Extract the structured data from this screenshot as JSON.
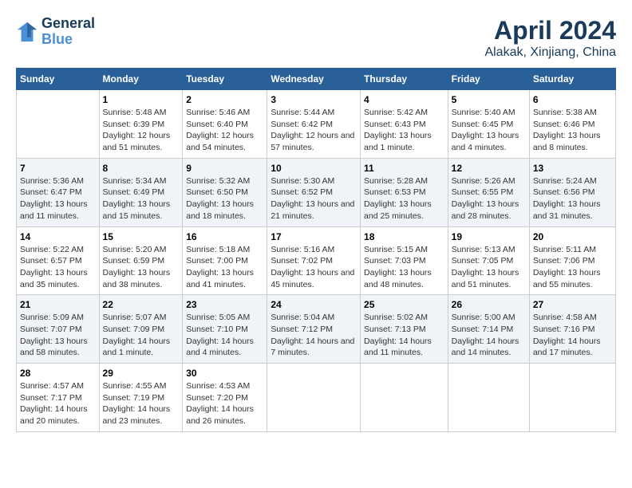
{
  "header": {
    "logo_line1": "General",
    "logo_line2": "Blue",
    "title": "April 2024",
    "subtitle": "Alakak, Xinjiang, China"
  },
  "weekdays": [
    "Sunday",
    "Monday",
    "Tuesday",
    "Wednesday",
    "Thursday",
    "Friday",
    "Saturday"
  ],
  "weeks": [
    [
      {
        "day": "",
        "sunrise": "",
        "sunset": "",
        "daylight": ""
      },
      {
        "day": "1",
        "sunrise": "Sunrise: 5:48 AM",
        "sunset": "Sunset: 6:39 PM",
        "daylight": "Daylight: 12 hours and 51 minutes."
      },
      {
        "day": "2",
        "sunrise": "Sunrise: 5:46 AM",
        "sunset": "Sunset: 6:40 PM",
        "daylight": "Daylight: 12 hours and 54 minutes."
      },
      {
        "day": "3",
        "sunrise": "Sunrise: 5:44 AM",
        "sunset": "Sunset: 6:42 PM",
        "daylight": "Daylight: 12 hours and 57 minutes."
      },
      {
        "day": "4",
        "sunrise": "Sunrise: 5:42 AM",
        "sunset": "Sunset: 6:43 PM",
        "daylight": "Daylight: 13 hours and 1 minute."
      },
      {
        "day": "5",
        "sunrise": "Sunrise: 5:40 AM",
        "sunset": "Sunset: 6:45 PM",
        "daylight": "Daylight: 13 hours and 4 minutes."
      },
      {
        "day": "6",
        "sunrise": "Sunrise: 5:38 AM",
        "sunset": "Sunset: 6:46 PM",
        "daylight": "Daylight: 13 hours and 8 minutes."
      }
    ],
    [
      {
        "day": "7",
        "sunrise": "Sunrise: 5:36 AM",
        "sunset": "Sunset: 6:47 PM",
        "daylight": "Daylight: 13 hours and 11 minutes."
      },
      {
        "day": "8",
        "sunrise": "Sunrise: 5:34 AM",
        "sunset": "Sunset: 6:49 PM",
        "daylight": "Daylight: 13 hours and 15 minutes."
      },
      {
        "day": "9",
        "sunrise": "Sunrise: 5:32 AM",
        "sunset": "Sunset: 6:50 PM",
        "daylight": "Daylight: 13 hours and 18 minutes."
      },
      {
        "day": "10",
        "sunrise": "Sunrise: 5:30 AM",
        "sunset": "Sunset: 6:52 PM",
        "daylight": "Daylight: 13 hours and 21 minutes."
      },
      {
        "day": "11",
        "sunrise": "Sunrise: 5:28 AM",
        "sunset": "Sunset: 6:53 PM",
        "daylight": "Daylight: 13 hours and 25 minutes."
      },
      {
        "day": "12",
        "sunrise": "Sunrise: 5:26 AM",
        "sunset": "Sunset: 6:55 PM",
        "daylight": "Daylight: 13 hours and 28 minutes."
      },
      {
        "day": "13",
        "sunrise": "Sunrise: 5:24 AM",
        "sunset": "Sunset: 6:56 PM",
        "daylight": "Daylight: 13 hours and 31 minutes."
      }
    ],
    [
      {
        "day": "14",
        "sunrise": "Sunrise: 5:22 AM",
        "sunset": "Sunset: 6:57 PM",
        "daylight": "Daylight: 13 hours and 35 minutes."
      },
      {
        "day": "15",
        "sunrise": "Sunrise: 5:20 AM",
        "sunset": "Sunset: 6:59 PM",
        "daylight": "Daylight: 13 hours and 38 minutes."
      },
      {
        "day": "16",
        "sunrise": "Sunrise: 5:18 AM",
        "sunset": "Sunset: 7:00 PM",
        "daylight": "Daylight: 13 hours and 41 minutes."
      },
      {
        "day": "17",
        "sunrise": "Sunrise: 5:16 AM",
        "sunset": "Sunset: 7:02 PM",
        "daylight": "Daylight: 13 hours and 45 minutes."
      },
      {
        "day": "18",
        "sunrise": "Sunrise: 5:15 AM",
        "sunset": "Sunset: 7:03 PM",
        "daylight": "Daylight: 13 hours and 48 minutes."
      },
      {
        "day": "19",
        "sunrise": "Sunrise: 5:13 AM",
        "sunset": "Sunset: 7:05 PM",
        "daylight": "Daylight: 13 hours and 51 minutes."
      },
      {
        "day": "20",
        "sunrise": "Sunrise: 5:11 AM",
        "sunset": "Sunset: 7:06 PM",
        "daylight": "Daylight: 13 hours and 55 minutes."
      }
    ],
    [
      {
        "day": "21",
        "sunrise": "Sunrise: 5:09 AM",
        "sunset": "Sunset: 7:07 PM",
        "daylight": "Daylight: 13 hours and 58 minutes."
      },
      {
        "day": "22",
        "sunrise": "Sunrise: 5:07 AM",
        "sunset": "Sunset: 7:09 PM",
        "daylight": "Daylight: 14 hours and 1 minute."
      },
      {
        "day": "23",
        "sunrise": "Sunrise: 5:05 AM",
        "sunset": "Sunset: 7:10 PM",
        "daylight": "Daylight: 14 hours and 4 minutes."
      },
      {
        "day": "24",
        "sunrise": "Sunrise: 5:04 AM",
        "sunset": "Sunset: 7:12 PM",
        "daylight": "Daylight: 14 hours and 7 minutes."
      },
      {
        "day": "25",
        "sunrise": "Sunrise: 5:02 AM",
        "sunset": "Sunset: 7:13 PM",
        "daylight": "Daylight: 14 hours and 11 minutes."
      },
      {
        "day": "26",
        "sunrise": "Sunrise: 5:00 AM",
        "sunset": "Sunset: 7:14 PM",
        "daylight": "Daylight: 14 hours and 14 minutes."
      },
      {
        "day": "27",
        "sunrise": "Sunrise: 4:58 AM",
        "sunset": "Sunset: 7:16 PM",
        "daylight": "Daylight: 14 hours and 17 minutes."
      }
    ],
    [
      {
        "day": "28",
        "sunrise": "Sunrise: 4:57 AM",
        "sunset": "Sunset: 7:17 PM",
        "daylight": "Daylight: 14 hours and 20 minutes."
      },
      {
        "day": "29",
        "sunrise": "Sunrise: 4:55 AM",
        "sunset": "Sunset: 7:19 PM",
        "daylight": "Daylight: 14 hours and 23 minutes."
      },
      {
        "day": "30",
        "sunrise": "Sunrise: 4:53 AM",
        "sunset": "Sunset: 7:20 PM",
        "daylight": "Daylight: 14 hours and 26 minutes."
      },
      {
        "day": "",
        "sunrise": "",
        "sunset": "",
        "daylight": ""
      },
      {
        "day": "",
        "sunrise": "",
        "sunset": "",
        "daylight": ""
      },
      {
        "day": "",
        "sunrise": "",
        "sunset": "",
        "daylight": ""
      },
      {
        "day": "",
        "sunrise": "",
        "sunset": "",
        "daylight": ""
      }
    ]
  ]
}
